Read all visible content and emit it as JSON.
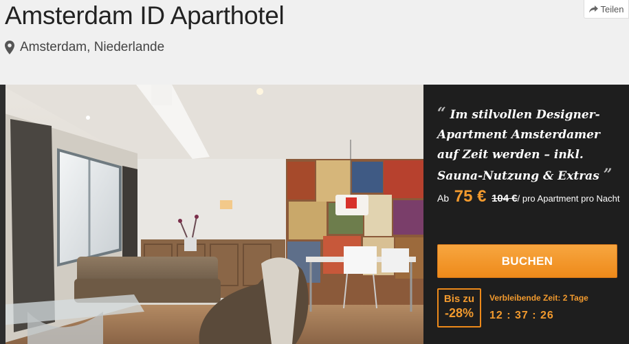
{
  "hotel": {
    "title": "Amsterdam ID Aparthotel",
    "location": "Amsterdam, Niederlande"
  },
  "share": {
    "label": "Teilen"
  },
  "offer": {
    "quote_open": "“",
    "quote_text": "Im stilvollen Designer-Apartment Amsterdamer auf Zeit werden – inkl. Sauna-Nutzung & Extras",
    "quote_close": "”",
    "price_prefix": "Ab",
    "price": "75 €",
    "old_price": "104 €",
    "price_suffix": "/ pro Apartment pro Nacht",
    "book_label": "BUCHEN",
    "discount_line1": "Bis zu",
    "discount_line2": "-28%",
    "remaining_label": "Verbleibende Zeit: 2 Tage",
    "countdown": "12 : 37 : 26"
  },
  "colors": {
    "accent": "#f29a2e",
    "panel_bg": "#1e1e1e",
    "header_bg": "#f0f0f0"
  },
  "icons": {
    "location": "map-pin-icon",
    "share": "share-arrow-icon"
  }
}
